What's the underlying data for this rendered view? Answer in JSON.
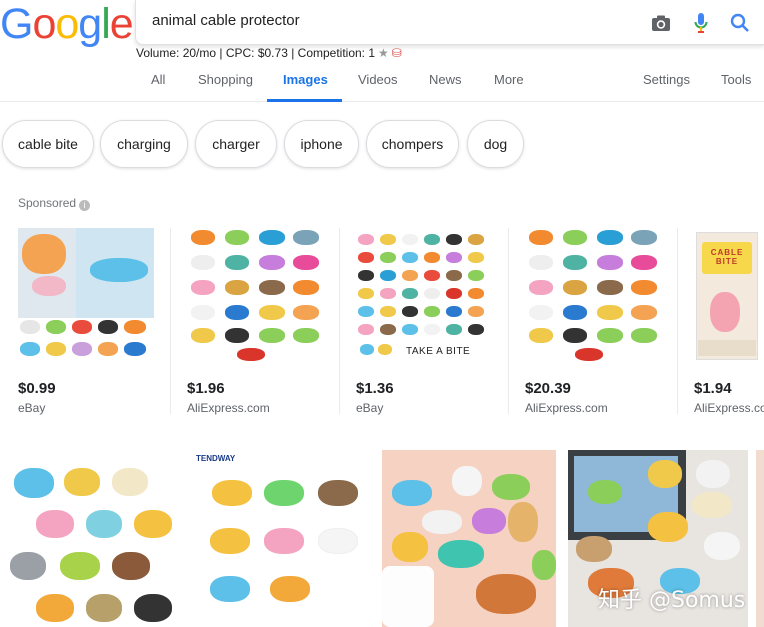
{
  "logo": {
    "letters": [
      "G",
      "o",
      "o",
      "g",
      "l",
      "e"
    ],
    "colors": [
      "#4285f4",
      "#ea4335",
      "#fbbc05",
      "#4285f4",
      "#34a853",
      "#ea4335"
    ]
  },
  "search": {
    "query": "animal cable protector"
  },
  "icons": {
    "camera": "camera-icon",
    "mic": "microphone-icon",
    "search": "search-icon"
  },
  "meta": {
    "text": "Volume: 20/mo | CPC: $0.73 | Competition: 1"
  },
  "tabs": {
    "items": [
      {
        "label": "All"
      },
      {
        "label": "Shopping"
      },
      {
        "label": "Images"
      },
      {
        "label": "Videos"
      },
      {
        "label": "News"
      },
      {
        "label": "More"
      },
      {
        "label": "Settings"
      },
      {
        "label": "Tools"
      }
    ],
    "active": "Images",
    "accent": "#1a73e8"
  },
  "chips": [
    {
      "label": "cable bite"
    },
    {
      "label": "charging"
    },
    {
      "label": "charger"
    },
    {
      "label": "iphone"
    },
    {
      "label": "chompers"
    },
    {
      "label": "dog"
    }
  ],
  "sponsored": {
    "label": "Sponsored"
  },
  "products": [
    {
      "price": "$0.99",
      "seller": "eBay"
    },
    {
      "price": "$1.96",
      "seller": "AliExpress.com"
    },
    {
      "price": "$1.36",
      "seller": "eBay",
      "overlay": "TAKE A BITE"
    },
    {
      "price": "$20.39",
      "seller": "AliExpress.com"
    },
    {
      "price": "$1.94",
      "seller": "AliExpress.com",
      "overlay": "CABLE BITE"
    }
  ],
  "results": [
    {
      "caption": ""
    },
    {
      "caption": "TENDWAY"
    },
    {
      "caption": ""
    },
    {
      "caption": ""
    }
  ],
  "watermark": "知乎 @Somus"
}
